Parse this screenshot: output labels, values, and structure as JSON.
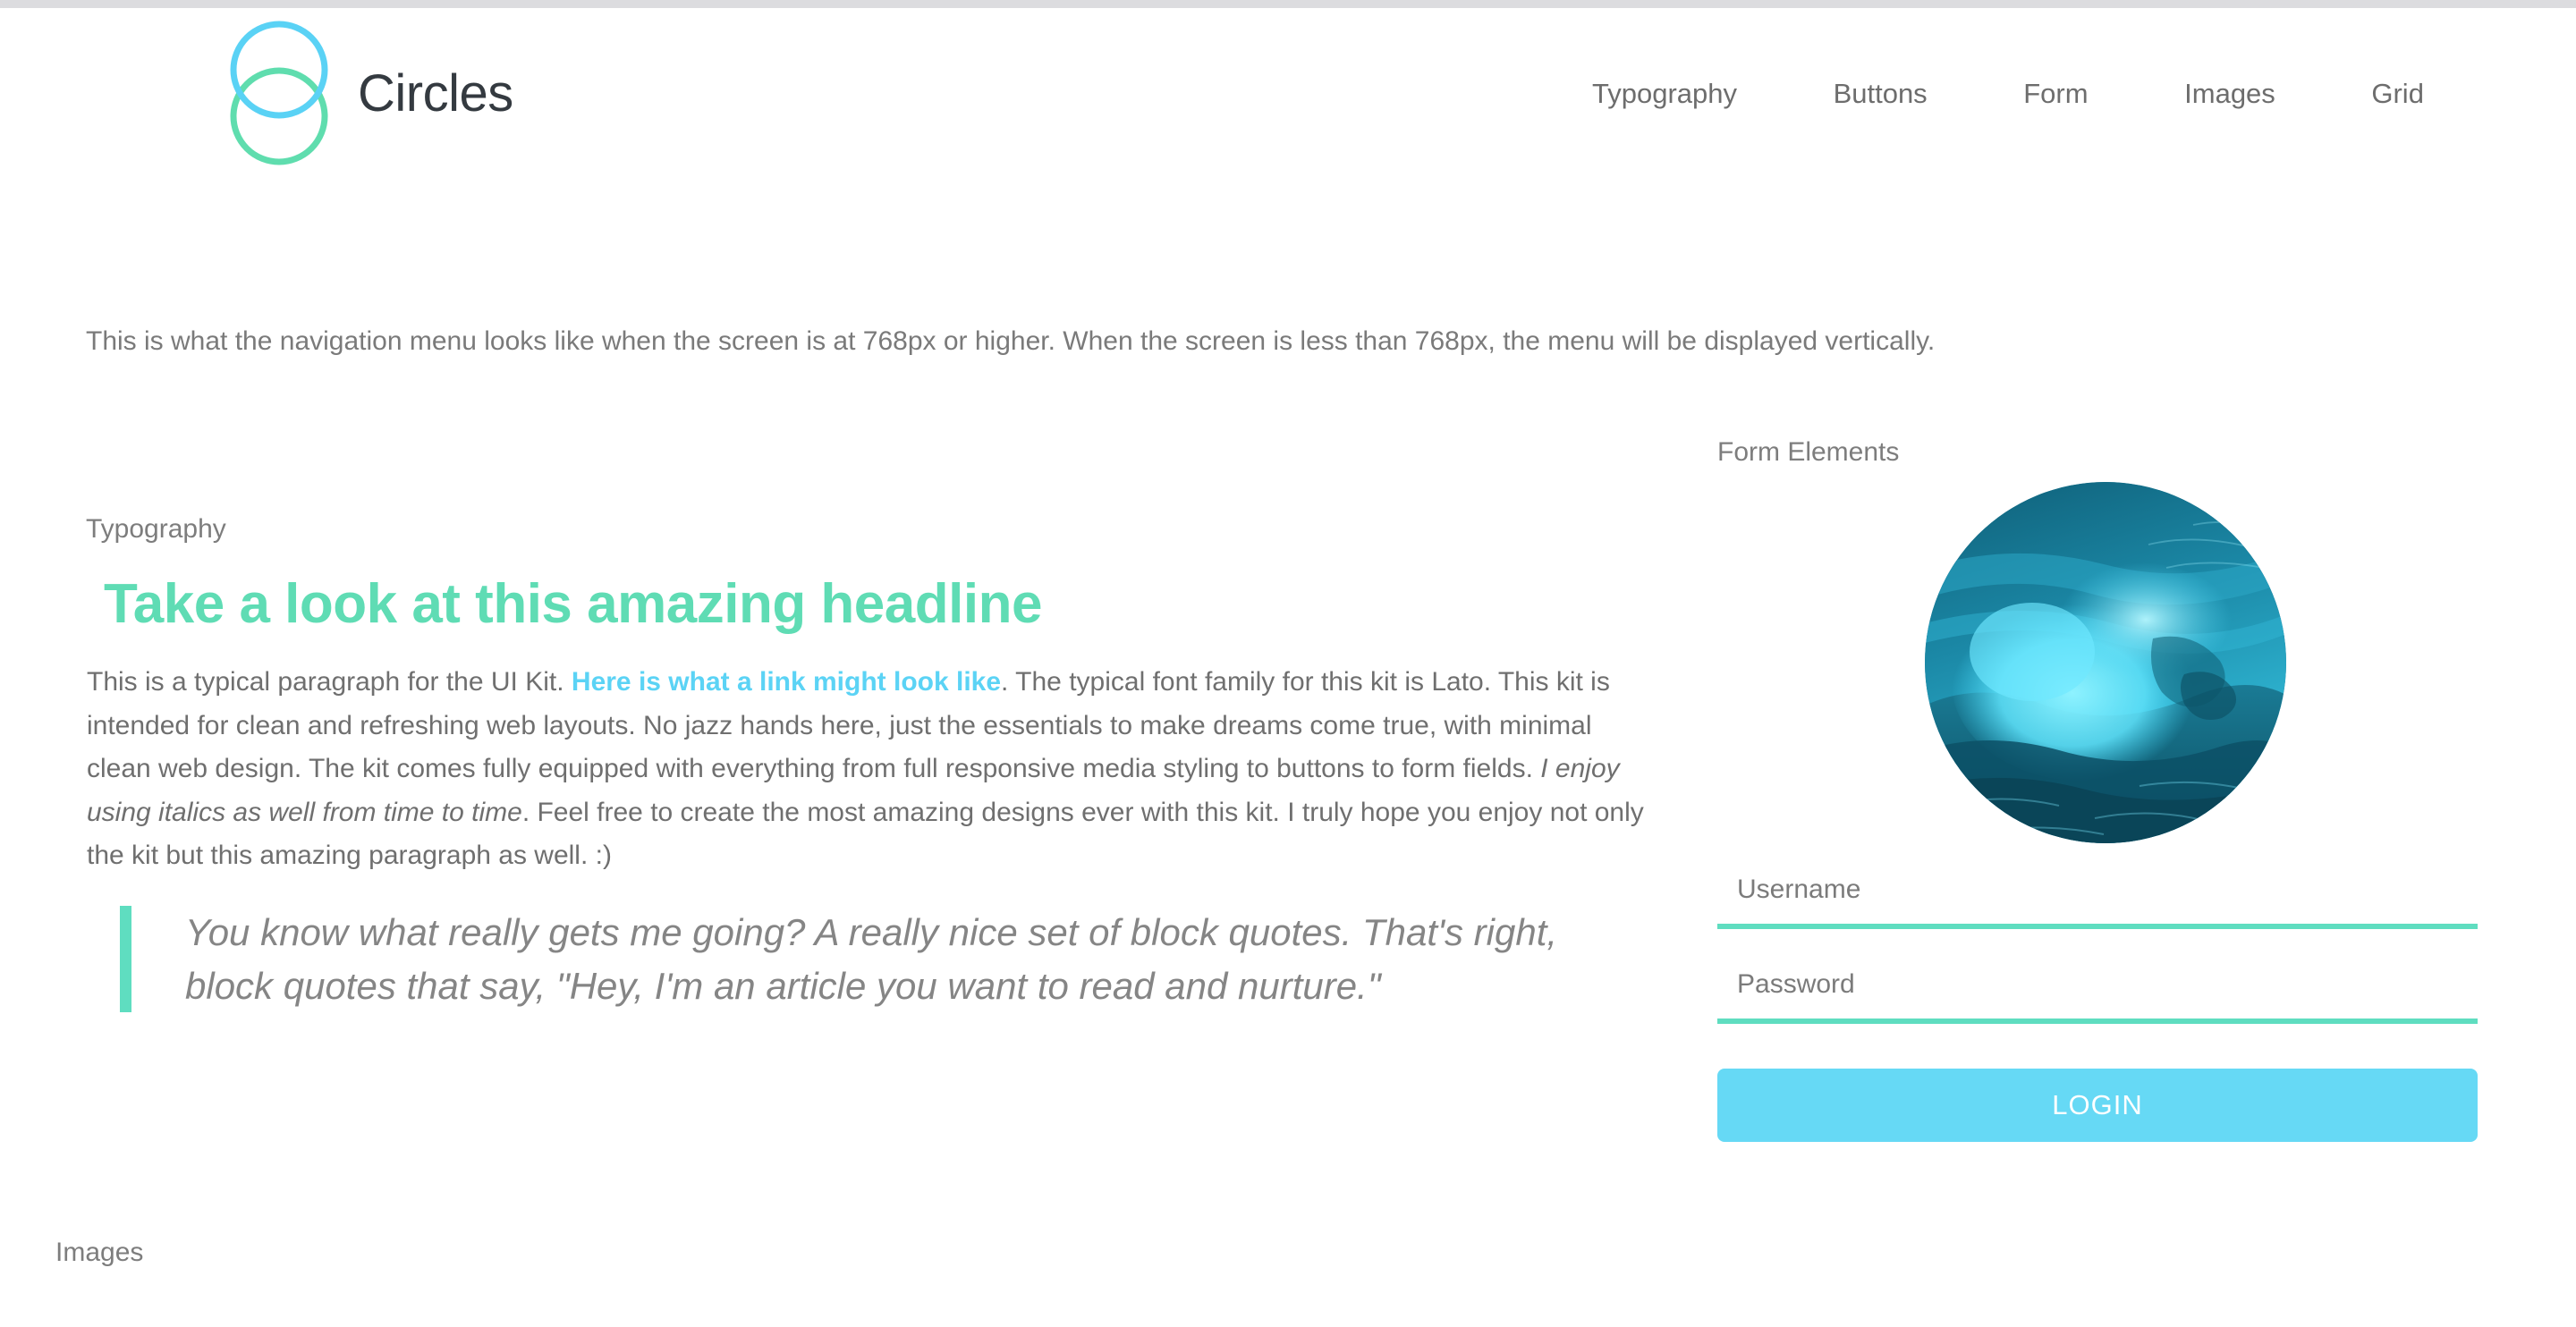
{
  "brand": {
    "name": "Circles",
    "logo_icon": "two-overlapping-circles-icon",
    "circle_top_color": "#5ad2f5",
    "circle_bottom_color": "#5fddae"
  },
  "nav": {
    "items": [
      {
        "label": "Typography"
      },
      {
        "label": "Buttons"
      },
      {
        "label": "Form"
      },
      {
        "label": "Images"
      },
      {
        "label": "Grid"
      }
    ]
  },
  "intro": {
    "note": "This is what the navigation menu looks like when the screen is at 768px or higher. When the screen is less than 768px, the menu will be displayed vertically."
  },
  "typography": {
    "section_label": "Typography",
    "headline": "Take a look at this amazing headline",
    "headline_color": "#5fdcb4",
    "paragraph": {
      "part1": "This is a typical paragraph for the UI Kit. ",
      "link_text": "Here is what a link might look like",
      "link_color": "#5bd3f5",
      "part2": ". The typical font family for this kit is Lato. This kit is intended for clean and refreshing web layouts. No jazz hands here, just the essentials to make dreams come true, with minimal clean web design. The kit comes fully equipped with everything from full responsive media styling to buttons to form fields. ",
      "italic_text": "I enjoy using italics as well from time to time",
      "part3": ". Feel free to create the most amazing designs ever with this kit. I truly hope you enjoy not only the kit but this amazing paragraph as well. :)"
    },
    "blockquote": {
      "text": "You know what really gets me going? A really nice set of block quotes. That's right, block quotes that say, \"Hey, I'm an article you want to read and nurture.\"",
      "accent_color": "#5fddc0"
    }
  },
  "form": {
    "section_label": "Form Elements",
    "avatar_icon": "ocean-wave-avatar-image",
    "username": {
      "label": "Username",
      "placeholder": "Username",
      "value": ""
    },
    "password": {
      "label": "Password",
      "placeholder": "Password",
      "value": ""
    },
    "login_button_label": "LOGIN",
    "login_button_color": "#66d9f5",
    "input_underline_color": "#5fddc0"
  },
  "images": {
    "section_label": "Images"
  }
}
